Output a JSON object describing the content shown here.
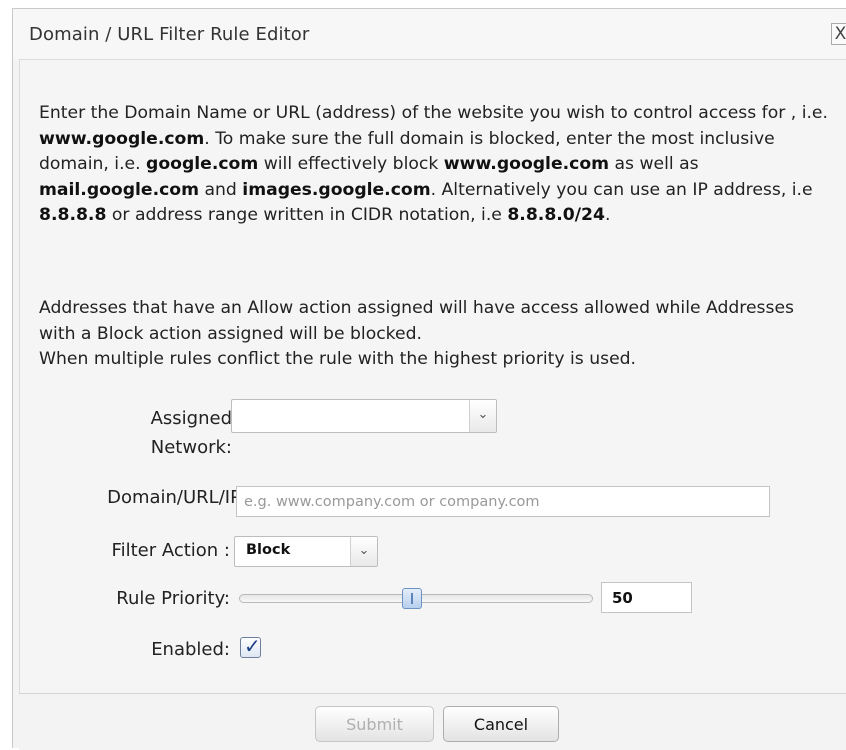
{
  "dialog": {
    "title": "Domain / URL Filter Rule Editor",
    "close_label": "X"
  },
  "intro": {
    "p1": [
      {
        "t": "Enter the Domain Name or URL (address) of the website you wish to control access for , i.e. ",
        "b": false
      },
      {
        "t": "www.google.com",
        "b": true
      },
      {
        "t": ". To make sure the full domain is blocked, enter the most inclusive domain, i.e. ",
        "b": false
      },
      {
        "t": "google.com",
        "b": true
      },
      {
        "t": " will effectively block ",
        "b": false
      },
      {
        "t": "www.google.com",
        "b": true
      },
      {
        "t": " as well as ",
        "b": false
      },
      {
        "t": "mail.google.com",
        "b": true
      },
      {
        "t": " and ",
        "b": false
      },
      {
        "t": "images.google.com",
        "b": true
      },
      {
        "t": ". Alternatively you can use an IP address, i.e ",
        "b": false
      },
      {
        "t": "8.8.8.8",
        "b": true
      },
      {
        "t": " or address range written in CIDR notation, i.e ",
        "b": false
      },
      {
        "t": "8.8.8.0/24",
        "b": true
      },
      {
        "t": ".",
        "b": false
      }
    ],
    "p2": [
      {
        "t": "Addresses that have an Allow action assigned will have access allowed while Addresses with a Block action assigned will be blocked.",
        "b": false
      },
      {
        "t": "\n",
        "b": false
      },
      {
        "t": "When multiple rules conflict the rule with the highest priority is used.",
        "b": false
      }
    ]
  },
  "form": {
    "assigned_network": {
      "label": "Assigned Network:",
      "value": ""
    },
    "domain": {
      "label": "Domain/URL/IP:",
      "value": "",
      "placeholder": "e.g. www.company.com or company.com"
    },
    "filter_action": {
      "label": "Filter Action :",
      "value": "Block"
    },
    "rule_priority": {
      "label": "Rule Priority:",
      "value": "50",
      "slider_fraction": 0.5
    },
    "enabled": {
      "label": "Enabled:",
      "checked": true,
      "check_glyph": "✓"
    },
    "dropdown_glyph": "⌄"
  },
  "footer": {
    "submit_label": "Submit",
    "cancel_label": "Cancel"
  }
}
